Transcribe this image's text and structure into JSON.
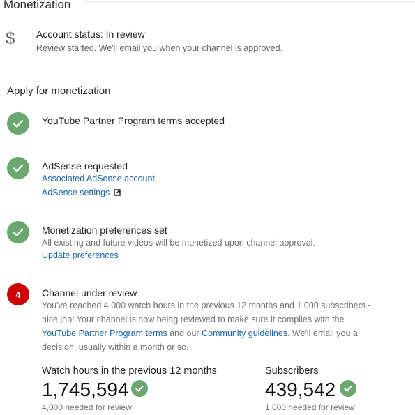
{
  "header": {
    "title": "Monetization"
  },
  "account_status": {
    "icon": "dollar-icon",
    "title": "Account status: In review",
    "description": "Review started. We'll email you when your channel is approved."
  },
  "apply": {
    "heading": "Apply for monetization",
    "steps": [
      {
        "state": "done",
        "icon": "check-circle-icon",
        "title": "YouTube Partner Program terms accepted"
      },
      {
        "state": "done",
        "icon": "check-circle-icon",
        "title": "AdSense requested",
        "links": [
          "Associated AdSense account",
          "AdSense settings"
        ]
      },
      {
        "state": "done",
        "icon": "check-circle-icon",
        "title": "Monetization preferences set",
        "description": "All existing and future videos will be monetized upon channel approval.",
        "link": "Update preferences"
      },
      {
        "state": "pending",
        "number": "4",
        "title": "Channel under review",
        "text_before": "You've reached 4,000 watch hours in the previous 12 months and 1,000 subscribers - nice job! Your channel is now being reviewed to make sure it complies with the ",
        "terms_link": "YouTube Partner Program terms",
        "text_middle": " and our ",
        "guidelines_link": "Community guidelines",
        "text_after": ". We'll email you a decision, usually within a month or so."
      }
    ]
  },
  "metrics": {
    "watch_hours": {
      "label": "Watch hours in the previous 12 months",
      "value": "1,745,594",
      "note": "4,000 needed for review"
    },
    "subscribers": {
      "label": "Subscribers",
      "value": "439,542",
      "note": "1,000 needed for review"
    }
  },
  "colors": {
    "success": "#6aa86f",
    "alert": "#cc0000",
    "link": "#1a63a8"
  }
}
